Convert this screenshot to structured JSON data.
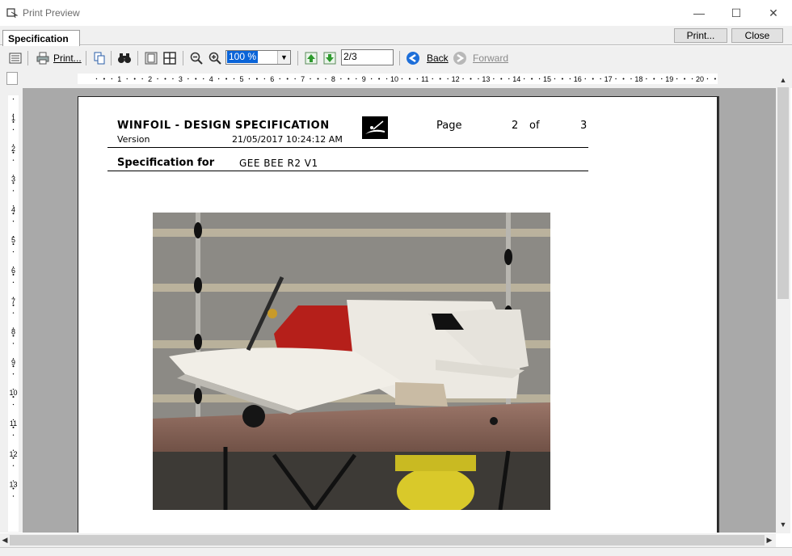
{
  "window": {
    "title": "Print Preview",
    "minimize": "—",
    "maximize": "☐",
    "close": "✕"
  },
  "header": {
    "tab": "Specification",
    "print_button": "Print...",
    "close_button": "Close"
  },
  "toolbar": {
    "print_label": "Print...",
    "zoom_value": "100 %",
    "page_value": "2/3",
    "back_label": "Back",
    "forward_label": "Forward"
  },
  "ruler": {
    "h_labels": [
      "1",
      "2",
      "3",
      "4",
      "5",
      "6",
      "7",
      "8",
      "9",
      "10",
      "11",
      "12",
      "13",
      "14",
      "15",
      "16",
      "17",
      "18",
      "19",
      "20"
    ],
    "v_labels": [
      "1",
      "2",
      "3",
      "4",
      "5",
      "6",
      "7",
      "8",
      "9",
      "10",
      "11",
      "12",
      "13"
    ]
  },
  "document": {
    "title": "WINFOIL - DESIGN SPECIFICATION",
    "version_label": "Version",
    "version_date": "21/05/2017 10:24:12 AM",
    "page_word": "Page",
    "page_num": "2",
    "of_word": "of",
    "page_total": "3",
    "spec_for_label": "Specification for",
    "spec_name": "GEE BEE R2 V1"
  },
  "colors": {
    "accent": "#0a64d8",
    "workspace": "#a9a9a9",
    "chrome": "#f0f0f0"
  }
}
